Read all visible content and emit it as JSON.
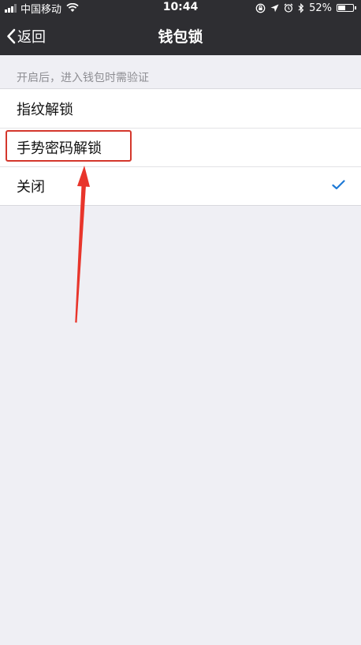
{
  "status_bar": {
    "carrier": "中国移动",
    "time": "10:44",
    "battery_percent": "52%",
    "battery_level": 0.52,
    "icons": [
      "signal-icon",
      "wifi-icon",
      "orientation-lock-icon",
      "location-icon",
      "alarm-icon",
      "bluetooth-icon",
      "battery-icon"
    ]
  },
  "nav": {
    "back_label": "返回",
    "title": "钱包锁"
  },
  "section": {
    "header": "开启后，进入钱包时需验证"
  },
  "options": [
    {
      "label": "指纹解锁",
      "selected": false
    },
    {
      "label": "手势密码解锁",
      "selected": false,
      "highlighted": true
    },
    {
      "label": "关闭",
      "selected": true
    }
  ],
  "colors": {
    "nav_background": "#2e2e32",
    "page_background": "#efeff4",
    "checkmark": "#1f7ad6",
    "annotation": "#d4372c"
  }
}
